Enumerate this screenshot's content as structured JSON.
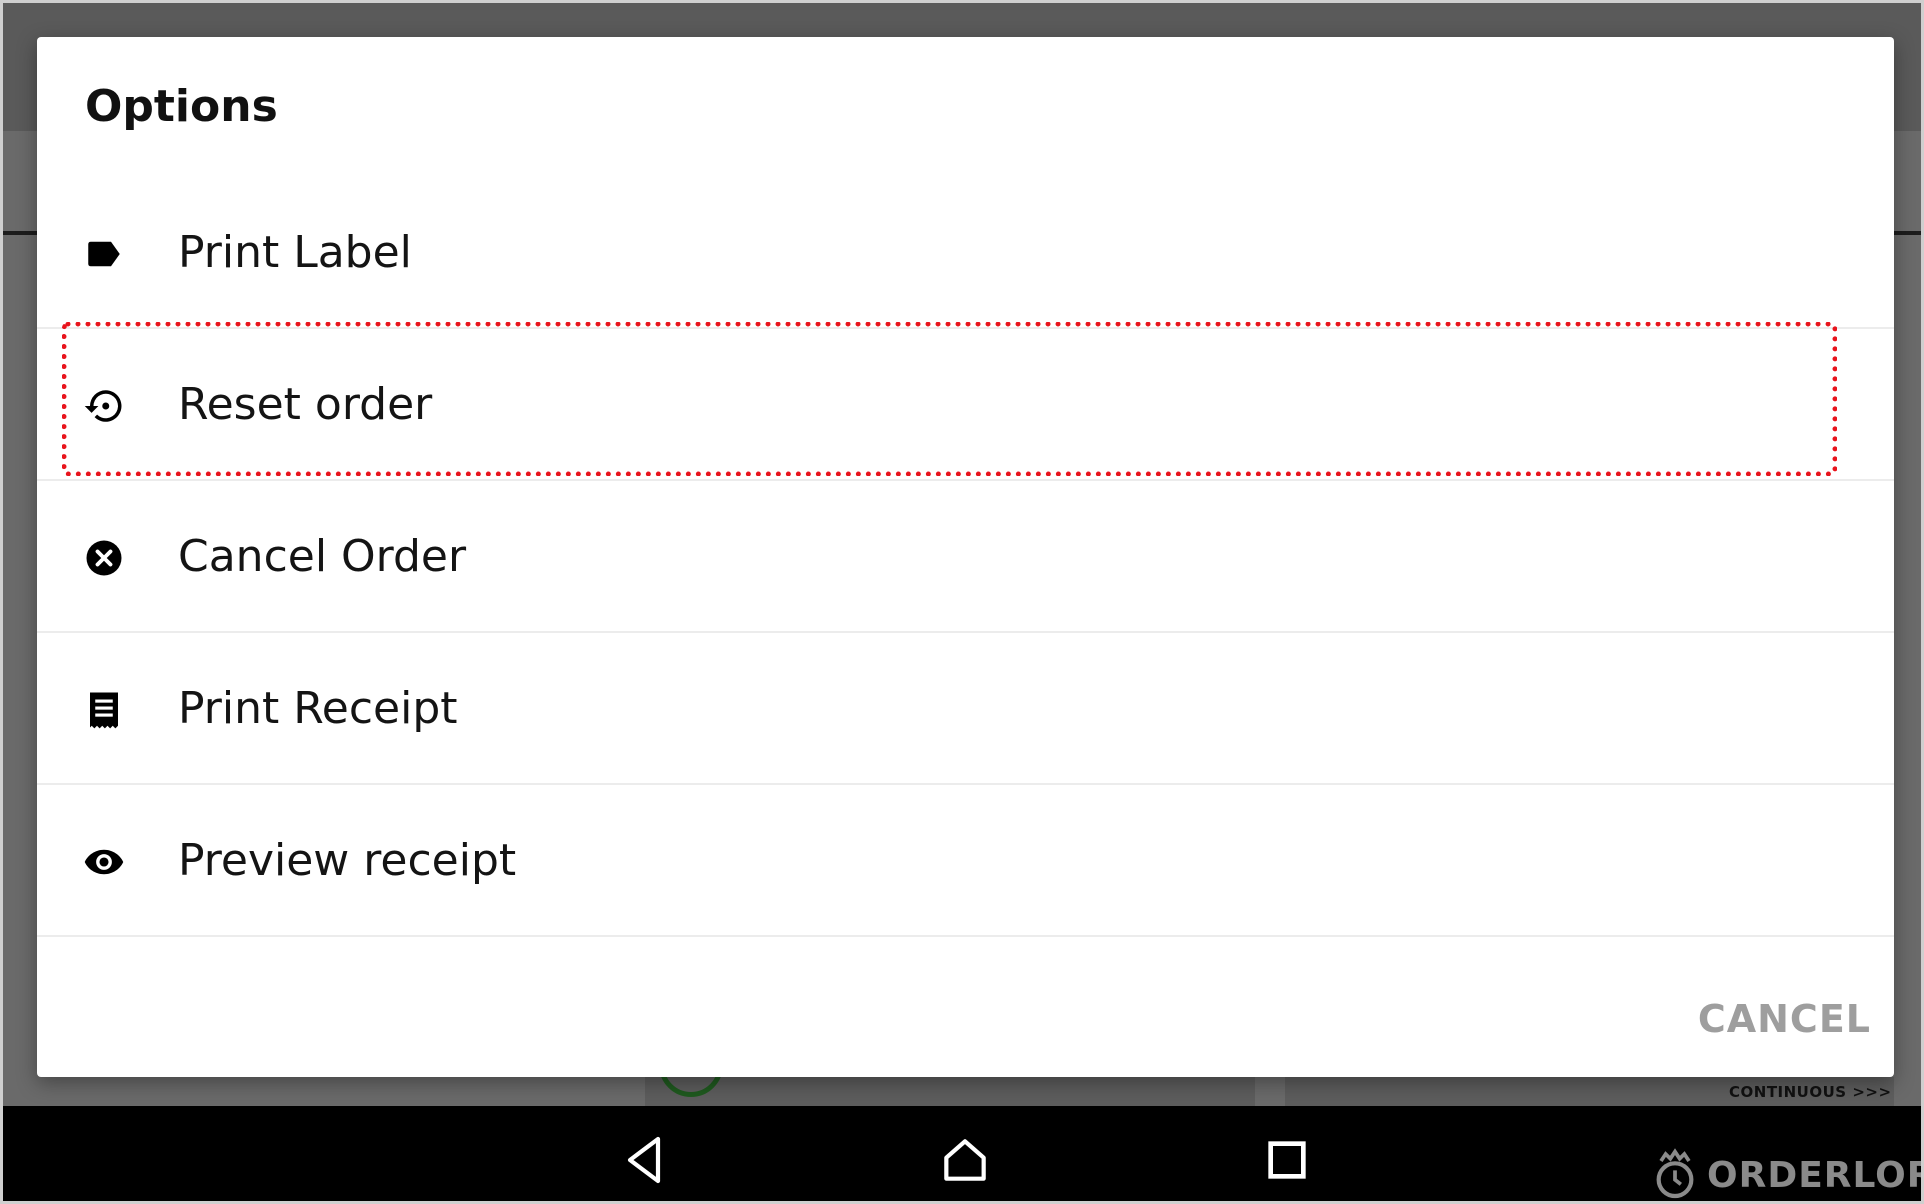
{
  "dialog": {
    "title": "Options",
    "options": [
      {
        "label": "Print Label",
        "icon": "label-icon"
      },
      {
        "label": "Reset order",
        "icon": "restore-icon"
      },
      {
        "label": "Cancel Order",
        "icon": "cancel-circle-icon"
      },
      {
        "label": "Print Receipt",
        "icon": "receipt-icon"
      },
      {
        "label": "Preview receipt",
        "icon": "eye-icon"
      }
    ],
    "cancel_label": "CANCEL"
  },
  "background": {
    "continuous_label": "CONTINUOUS >>>"
  },
  "navbar": {
    "items": [
      "back-icon",
      "home-icon",
      "recents-icon"
    ]
  },
  "brand": {
    "name": "ORDERLORD"
  },
  "colors": {
    "highlight": "#e8141c",
    "cancel_text": "#9e9e9e",
    "overlay": "#6a6a6a",
    "navbar": "#000000"
  }
}
